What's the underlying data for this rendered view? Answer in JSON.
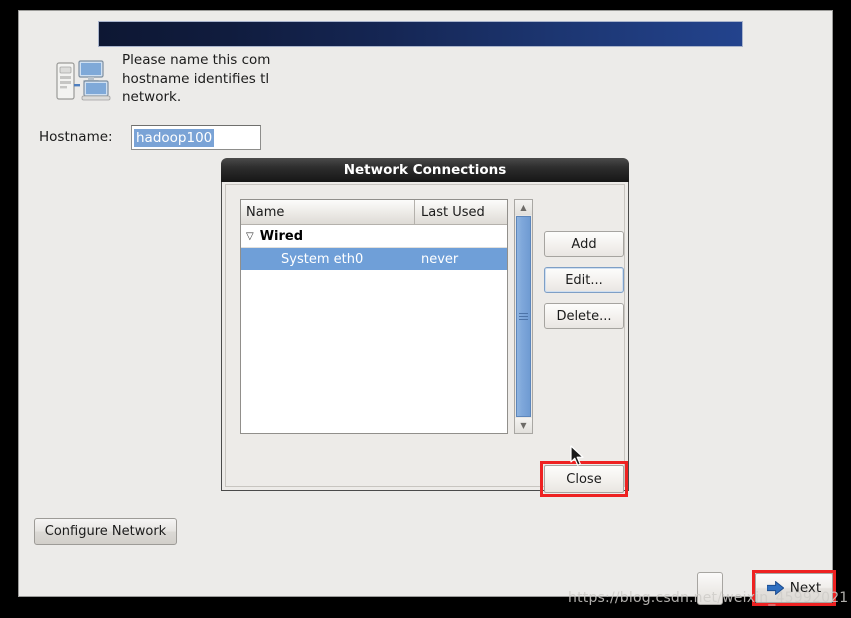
{
  "installer": {
    "intro_lines": [
      "Please name this com",
      "hostname identifies tl",
      "network."
    ],
    "hostname_label": "Hostname:",
    "hostname_value": "hadoop100",
    "configure_network_label": "Configure Network",
    "next_label": "Next",
    "icons": {
      "network_computers": "network-computers-icon",
      "next_arrow": "arrow-right-icon"
    }
  },
  "dialog": {
    "title": "Network Connections",
    "columns": [
      "Name",
      "Last Used"
    ],
    "groups": [
      {
        "label": "Wired",
        "expanded": true,
        "rows": [
          {
            "name": "System eth0",
            "last_used": "never",
            "selected": true
          }
        ]
      }
    ],
    "buttons": {
      "add": "Add",
      "edit": "Edit...",
      "delete": "Delete...",
      "close": "Close"
    }
  },
  "annotations": {
    "watermark": "https://blog.csdn.net/weixin_45992021",
    "highlight_color": "#ee2222"
  }
}
